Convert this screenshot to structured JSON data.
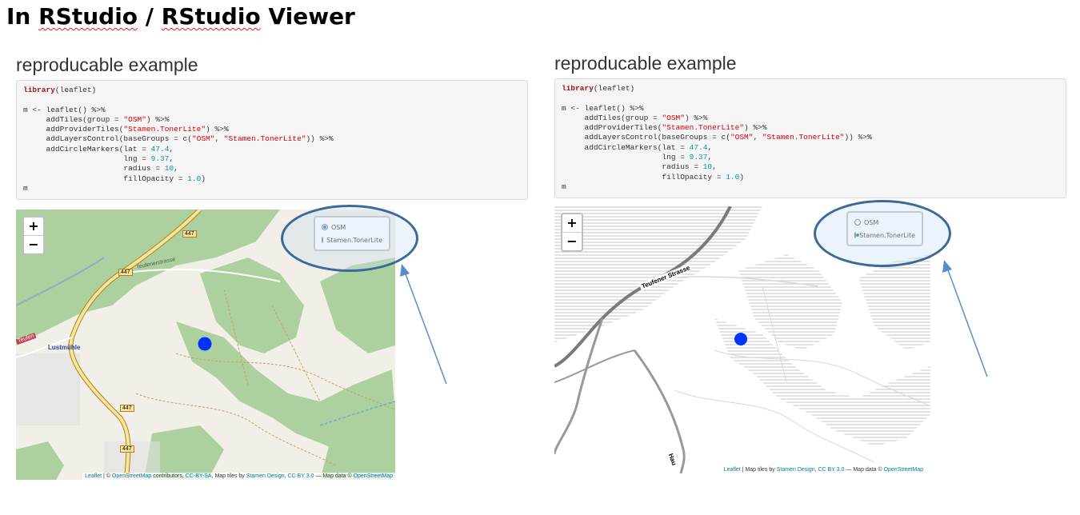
{
  "page": {
    "title_prefix": "In ",
    "title_word1": "RStudio",
    "title_sep": " / ",
    "title_word2": "RStudio",
    "title_suffix": " Viewer"
  },
  "left": {
    "heading": "reproducable example",
    "layers": {
      "osm": "OSM",
      "toner": "Stamen.TonerLite",
      "selected": "OSM"
    },
    "zoom_in": "+",
    "zoom_out": "−",
    "labels": {
      "road_447_a": "447",
      "road_447_b": "447",
      "road_447_c": "447",
      "road_447_d": "447",
      "street": "Teufenerstrasse",
      "town": "Lustmühle",
      "village": "Teufen"
    },
    "attribution": {
      "leaflet": "Leaflet",
      "sep1": " | © ",
      "osm": "OpenStreetMap",
      "t1": " contributors, ",
      "ccbysa": "CC-BY-SA",
      "t2": ", Map tiles by ",
      "stamen": "Stamen Design",
      "t3": ", ",
      "ccby": "CC BY 3.0",
      "t4": " — Map data © ",
      "osm2": "OpenStreetMap"
    }
  },
  "right": {
    "heading": "reproducable example",
    "layers": {
      "osm": "OSM",
      "toner": "Stamen.TonerLite",
      "selected": "Stamen.TonerLite"
    },
    "zoom_in": "+",
    "zoom_out": "−",
    "labels": {
      "street": "Teufener Strasse",
      "road_bottom": "Hau"
    },
    "attribution": {
      "leaflet": "Leaflet",
      "t1": " | Map tiles by ",
      "stamen": "Stamen Design",
      "t2": ", ",
      "ccby": "CC BY 3.0",
      "t3": " — Map data © ",
      "osm": "OpenStreetMap"
    }
  },
  "code": {
    "l1_fn": "library",
    "l1_rest": "(leaflet)",
    "l2": "m <- leaflet() %>%",
    "l3a": "     addTiles(group = ",
    "l3s": "\"OSM\"",
    "l3b": ") %>%",
    "l4a": "     addProviderTiles(",
    "l4s": "\"Stamen.TonerLite\"",
    "l4b": ") %>%",
    "l5a": "     addLayersControl(baseGroups = c(",
    "l5s1": "\"OSM\"",
    "l5c": ", ",
    "l5s2": "\"Stamen.TonerLite\"",
    "l5b": ")) %>%",
    "l6a": "     addCircleMarkers(lat = ",
    "l6n": "47.4",
    "l6b": ",",
    "l7a": "                      lng = ",
    "l7n": "9.37",
    "l7b": ",",
    "l8a": "                      radius = ",
    "l8n": "10",
    "l8b": ",",
    "l9a": "                      fillOpacity = ",
    "l9n": "1.0",
    "l9b": ")",
    "l10": "m"
  },
  "colors": {
    "marker": "#0033ff",
    "osm_green": "#add19e",
    "osm_bg": "#f2efe9",
    "road_yellow": "#f7e59b",
    "annotation": "#3b6a9a"
  }
}
